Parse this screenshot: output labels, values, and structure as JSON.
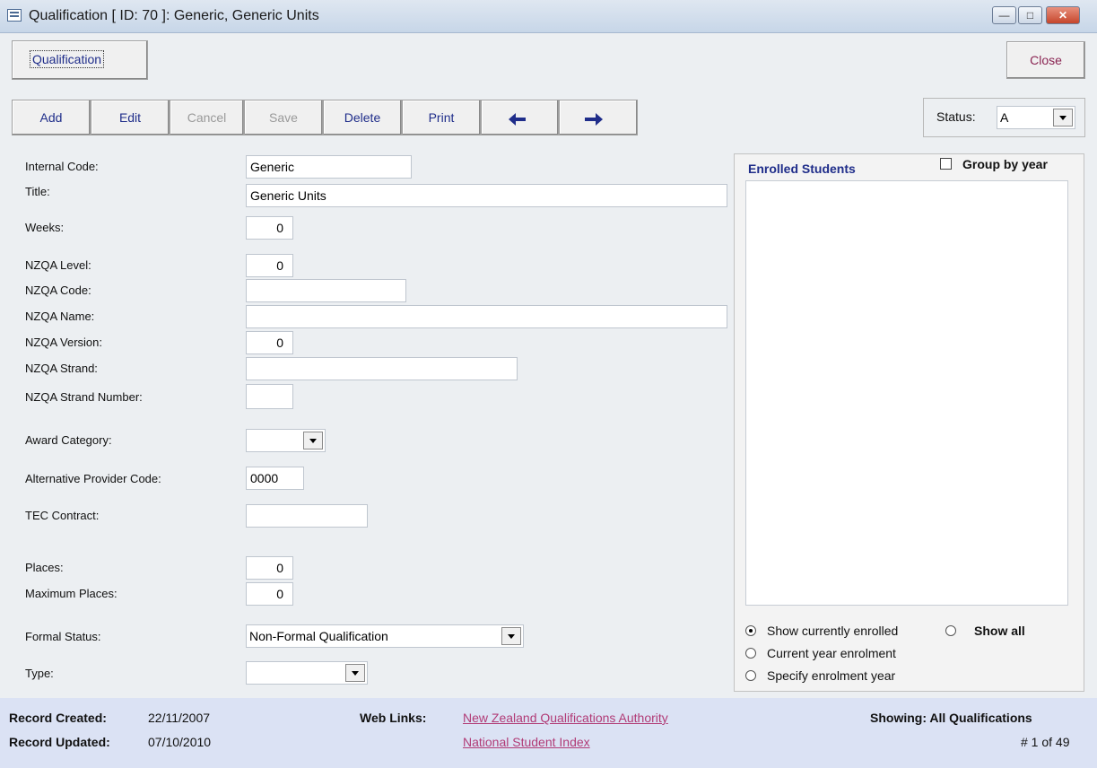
{
  "window": {
    "title": "Qualification [ ID: 70 ]: Generic, Generic Units"
  },
  "header": {
    "qualification_button": "Qualification",
    "close_button": "Close"
  },
  "toolbar": {
    "add": "Add",
    "edit": "Edit",
    "cancel": "Cancel",
    "save": "Save",
    "delete": "Delete",
    "print": "Print"
  },
  "status": {
    "label": "Status:",
    "value": "A"
  },
  "form": {
    "internal_code": {
      "label": "Internal Code:",
      "value": "Generic"
    },
    "title": {
      "label": "Title:",
      "value": "Generic Units"
    },
    "weeks": {
      "label": "Weeks:",
      "value": "0"
    },
    "nzqa_level": {
      "label": "NZQA Level:",
      "value": "0"
    },
    "nzqa_code": {
      "label": "NZQA Code:",
      "value": ""
    },
    "nzqa_name": {
      "label": "NZQA Name:",
      "value": ""
    },
    "nzqa_version": {
      "label": "NZQA Version:",
      "value": "0"
    },
    "nzqa_strand": {
      "label": "NZQA Strand:",
      "value": ""
    },
    "nzqa_strand_number": {
      "label": "NZQA Strand Number:",
      "value": ""
    },
    "award_category": {
      "label": "Award Category:",
      "value": ""
    },
    "alt_provider_code": {
      "label": "Alternative Provider Code:",
      "value": "0000"
    },
    "tec_contract": {
      "label": "TEC Contract:",
      "value": ""
    },
    "places": {
      "label": "Places:",
      "value": "0"
    },
    "max_places": {
      "label": "Maximum Places:",
      "value": "0"
    },
    "formal_status": {
      "label": "Formal Status:",
      "value": "Non-Formal Qualification"
    },
    "type": {
      "label": "Type:",
      "value": ""
    }
  },
  "enrolled": {
    "title": "Enrolled Students",
    "group_by_year": "Group by year",
    "show_current": "Show currently enrolled",
    "show_all": "Show all",
    "current_year": "Current year enrolment",
    "specify_year": "Specify enrolment year"
  },
  "footer": {
    "created_label": "Record Created:",
    "created_value": "22/11/2007",
    "updated_label": "Record Updated:",
    "updated_value": "07/10/2010",
    "web_links_label": "Web Links:",
    "link_nzqa": "New Zealand Qualifications Authority",
    "link_nsi": "National Student Index",
    "showing": "Showing: All Qualifications",
    "record_pos": "# 1 of 49"
  }
}
